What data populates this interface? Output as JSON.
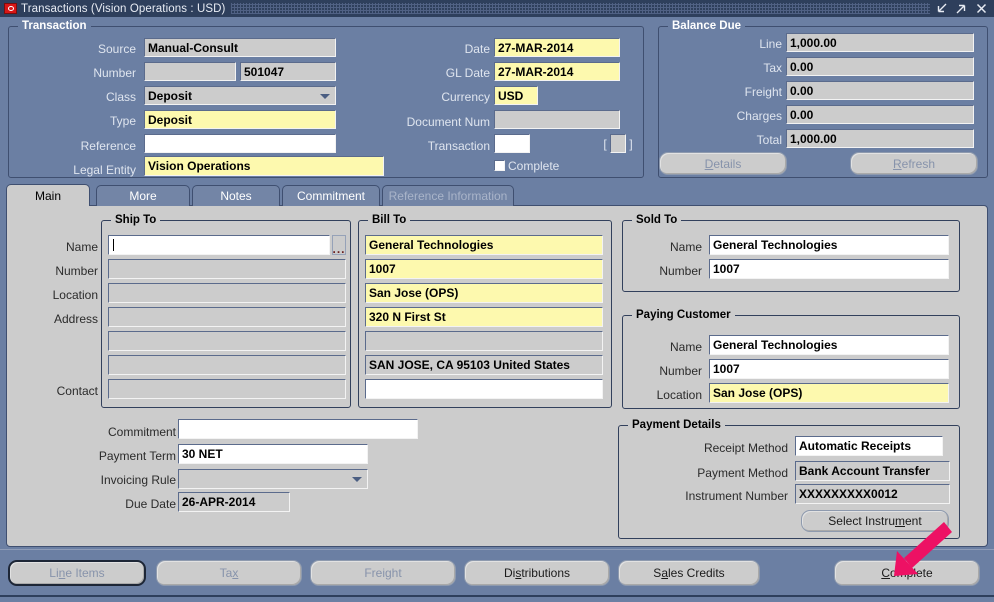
{
  "window": {
    "title": "Transactions (Vision Operations : USD)",
    "icon": "oracle-forms-icon",
    "controls": [
      {
        "name": "minimize-button",
        "icon": "arrow-down-left-icon"
      },
      {
        "name": "maximize-button",
        "icon": "arrow-up-right-icon"
      },
      {
        "name": "close-button",
        "icon": "close-x-icon"
      }
    ]
  },
  "colors": {
    "window_chrome": "#6b7fa3",
    "titlebar": "#2e3f5c",
    "canvas": "#cccccc",
    "field_readonly": "#cccccc",
    "field_required": "#fdf9ae",
    "field_editable": "#ffffff",
    "annotation_arrow": "#ed1164"
  },
  "transaction": {
    "group_label": "Transaction",
    "left": [
      {
        "label": "Source",
        "value": "Manual-Consult",
        "state": "readonly",
        "widget": "text"
      },
      {
        "label": "Number",
        "value": "",
        "state": "readonly",
        "widget": "text",
        "second_value": "501047"
      },
      {
        "label": "Class",
        "value": "Deposit",
        "state": "readonly",
        "widget": "poplist"
      },
      {
        "label": "Type",
        "value": "Deposit",
        "state": "required",
        "widget": "text"
      },
      {
        "label": "Reference",
        "value": "",
        "state": "editable",
        "widget": "text"
      },
      {
        "label": "Legal Entity",
        "value": "Vision Operations",
        "state": "required",
        "widget": "text"
      }
    ],
    "middle": [
      {
        "label": "Date",
        "value": "27-MAR-2014",
        "state": "required",
        "widget": "text"
      },
      {
        "label": "GL Date",
        "value": "27-MAR-2014",
        "state": "required",
        "widget": "text"
      },
      {
        "label": "Currency",
        "value": "USD",
        "state": "required",
        "widget": "text"
      },
      {
        "label": "Document Num",
        "value": "",
        "state": "readonly",
        "widget": "text"
      },
      {
        "label": "Transaction",
        "value": "",
        "state": "editable",
        "widget": "text",
        "bracket_open": "[",
        "bracket_close": "]",
        "flex_value": ""
      }
    ],
    "complete_checkbox": {
      "label": "Complete",
      "checked": false
    }
  },
  "balance_due": {
    "group_label": "Balance Due",
    "rows": [
      {
        "label": "Line",
        "value": "1,000.00"
      },
      {
        "label": "Tax",
        "value": "0.00"
      },
      {
        "label": "Freight",
        "value": "0.00"
      },
      {
        "label": "Charges",
        "value": "0.00"
      },
      {
        "label": "Total",
        "value": "1,000.00"
      }
    ],
    "buttons": [
      {
        "name": "details-button",
        "label": "Details",
        "mnemonic": "D",
        "disabled": true
      },
      {
        "name": "refresh-button",
        "label": "Refresh",
        "mnemonic": "R",
        "disabled": true
      }
    ]
  },
  "tabs": [
    {
      "label": "Main",
      "state": "active"
    },
    {
      "label": "More",
      "state": "inactive"
    },
    {
      "label": "Notes",
      "state": "inactive"
    },
    {
      "label": "Commitment",
      "state": "inactive"
    },
    {
      "label": "Reference Information",
      "state": "disabled"
    }
  ],
  "ship_to": {
    "group_label": "Ship To",
    "rows": [
      {
        "label": "Name",
        "value": "",
        "state": "editable",
        "lov": true,
        "cursor": true
      },
      {
        "label": "Number",
        "value": "",
        "state": "readonly"
      },
      {
        "label": "Location",
        "value": "",
        "state": "readonly"
      },
      {
        "label": "Address",
        "value": "",
        "state": "readonly"
      },
      {
        "label": "",
        "value": "",
        "state": "readonly"
      },
      {
        "label": "",
        "value": "",
        "state": "readonly"
      },
      {
        "label": "Contact",
        "value": "",
        "state": "readonly"
      }
    ],
    "lov_icon": "list-of-values-icon"
  },
  "bill_to": {
    "group_label": "Bill To",
    "rows": [
      {
        "value": "General Technologies",
        "state": "required"
      },
      {
        "value": "1007",
        "state": "required"
      },
      {
        "value": "San Jose (OPS)",
        "state": "required"
      },
      {
        "value": "320 N First St",
        "state": "required"
      },
      {
        "value": "",
        "state": "readonly"
      },
      {
        "value": "SAN JOSE, CA 95103 United States",
        "state": "readonly"
      },
      {
        "value": "",
        "state": "editable"
      }
    ]
  },
  "sold_to": {
    "group_label": "Sold To",
    "rows": [
      {
        "label": "Name",
        "value": "General Technologies",
        "state": "editable"
      },
      {
        "label": "Number",
        "value": "1007",
        "state": "editable"
      }
    ]
  },
  "paying_customer": {
    "group_label": "Paying Customer",
    "rows": [
      {
        "label": "Name",
        "value": "General Technologies",
        "state": "editable"
      },
      {
        "label": "Number",
        "value": "1007",
        "state": "editable"
      },
      {
        "label": "Location",
        "value": "San Jose (OPS)",
        "state": "required"
      }
    ]
  },
  "terms": [
    {
      "label": "Commitment",
      "value": "",
      "state": "editable",
      "widget": "text"
    },
    {
      "label": "Payment Term",
      "value": "30 NET",
      "state": "editable",
      "widget": "text"
    },
    {
      "label": "Invoicing Rule",
      "value": "",
      "state": "readonly",
      "widget": "poplist"
    },
    {
      "label": "Due Date",
      "value": "26-APR-2014",
      "state": "readonly",
      "widget": "text"
    }
  ],
  "payment_details": {
    "group_label": "Payment Details",
    "rows": [
      {
        "label": "Receipt Method",
        "value": "Automatic Receipts",
        "state": "editable"
      },
      {
        "label": "Payment Method",
        "value": "Bank Account Transfer",
        "state": "readonly"
      },
      {
        "label": "Instrument Number",
        "value": "XXXXXXXXX0012",
        "state": "readonly"
      }
    ],
    "button": {
      "name": "select-instrument-button",
      "label": "Select Instrument",
      "mnemonic": "m"
    }
  },
  "footer_buttons": [
    {
      "name": "line-items-button",
      "label": "Line Items",
      "mnemonic": "n",
      "disabled": true,
      "default": true
    },
    {
      "name": "tax-button",
      "label": "Tax",
      "mnemonic": "x",
      "disabled": true,
      "default": false
    },
    {
      "name": "freight-button",
      "label": "Freight",
      "mnemonic": "",
      "disabled": true,
      "default": false
    },
    {
      "name": "distributions-button",
      "label": "Distributions",
      "mnemonic": "s",
      "disabled": false,
      "default": false
    },
    {
      "name": "sales-credits-button",
      "label": "Sales Credits",
      "mnemonic": "a",
      "disabled": false,
      "default": false
    },
    {
      "name": "complete-button",
      "label": "Complete",
      "mnemonic": "C",
      "disabled": false,
      "default": false
    }
  ],
  "annotation": {
    "name": "pointer-arrow",
    "target": "complete-button",
    "color": "#ed1164"
  }
}
